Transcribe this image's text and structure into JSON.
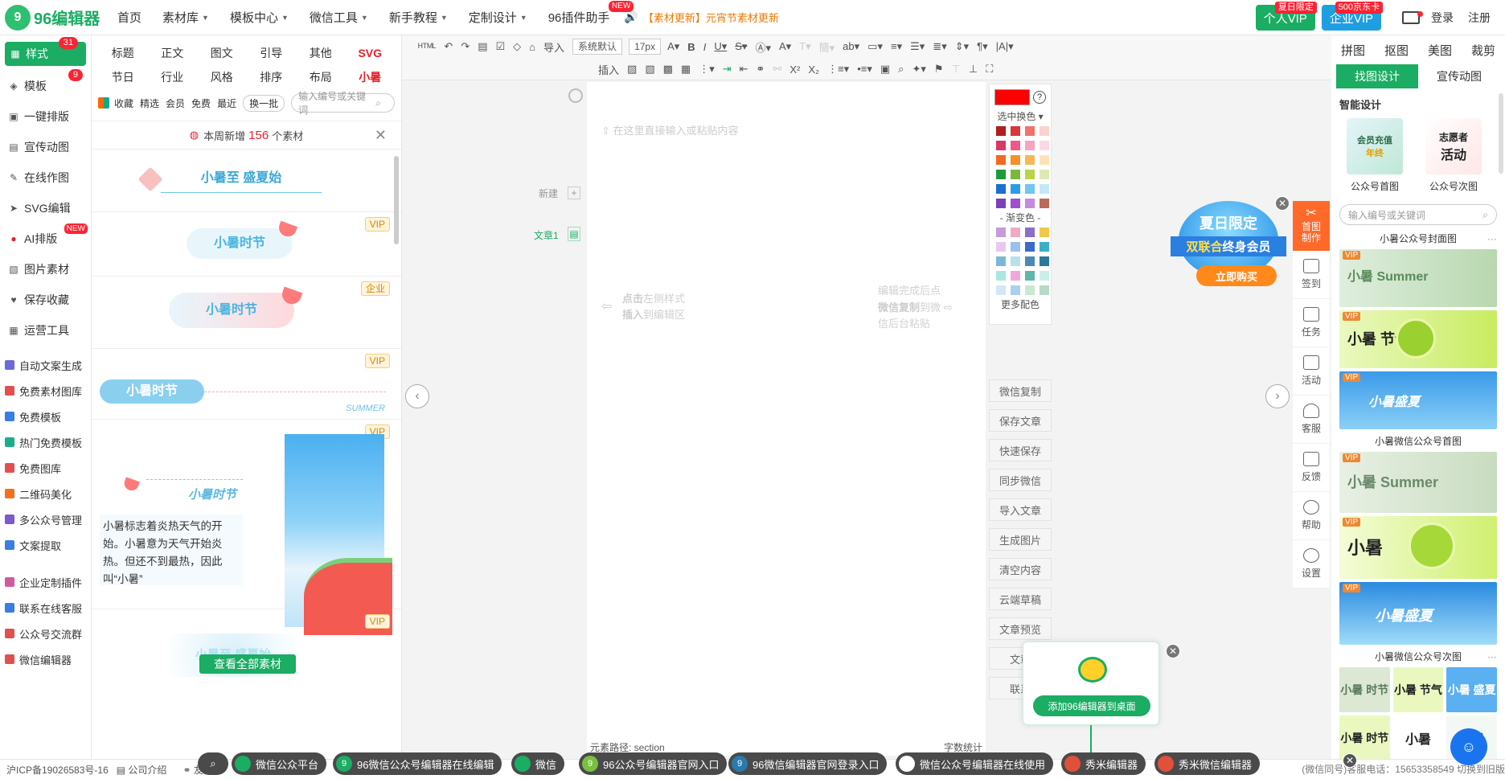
{
  "nav": {
    "logo_mark": "9",
    "logo_text": "96编辑器",
    "items": [
      {
        "label": "首页",
        "caret": false
      },
      {
        "label": "素材库",
        "caret": true
      },
      {
        "label": "模板中心",
        "caret": true
      },
      {
        "label": "微信工具",
        "caret": true
      },
      {
        "label": "新手教程",
        "caret": true
      },
      {
        "label": "定制设计",
        "caret": true
      },
      {
        "label": "96插件助手",
        "caret": false,
        "badge": "NEW"
      }
    ],
    "notice": "【素材更新】元宵节素材更新",
    "vip_personal": {
      "label": "个人VIP",
      "tag": "夏日限定",
      "color": "#1aad63"
    },
    "vip_enterprise": {
      "label": "企业VIP",
      "tag": "500京东卡",
      "color": "#1e9fe0"
    },
    "login": "登录",
    "register": "注册"
  },
  "sidebar": {
    "style": {
      "label": "样式",
      "count": "31"
    },
    "template": {
      "label": "模板",
      "count": "9"
    },
    "items": [
      "一键排版",
      "宣传动图",
      "在线作图",
      "SVG编辑",
      "AI排版",
      "图片素材",
      "保存收藏",
      "运营工具"
    ],
    "ai_badge": "NEW",
    "sub1": [
      {
        "label": "自动文案生成",
        "color": "#6a6ad8"
      },
      {
        "label": "免费素材图库",
        "color": "#e05050"
      },
      {
        "label": "免费模板",
        "color": "#3b7de0"
      },
      {
        "label": "热门免费模板",
        "color": "#1aad8a"
      },
      {
        "label": "免费图库",
        "color": "#e05050"
      },
      {
        "label": "二维码美化",
        "color": "#f07020"
      },
      {
        "label": "多公众号管理",
        "color": "#7a5ad0"
      },
      {
        "label": "文案提取",
        "color": "#3b7de0"
      }
    ],
    "sub2": [
      {
        "label": "企业定制插件",
        "color": "#d05aa0"
      },
      {
        "label": "联系在线客服",
        "color": "#3b7de0"
      },
      {
        "label": "公众号交流群",
        "color": "#e05050"
      },
      {
        "label": "微信编辑器",
        "color": "#e05050"
      }
    ]
  },
  "material": {
    "categories": [
      "标题",
      "正文",
      "图文",
      "引导",
      "其他",
      "SVG",
      "节日",
      "行业",
      "风格",
      "排序",
      "布局",
      "小暑"
    ],
    "filters": [
      "收藏",
      "精选",
      "会员",
      "免费",
      "最近"
    ],
    "swap": "换一批",
    "search_placeholder": "输入编号或关键词",
    "weekly_prefix": "本周新增",
    "weekly_count": "156",
    "weekly_suffix": "个素材",
    "items": [
      {
        "title": "小暑至 盛夏始",
        "tag": ""
      },
      {
        "title": "小暑时节",
        "tag": "VIP"
      },
      {
        "title": "小暑时节",
        "tag": "企业"
      },
      {
        "title": "小暑时节",
        "tag": "VIP",
        "sub": "SUMMER"
      },
      {
        "title": "小暑时节",
        "tag": "VIP",
        "body": "小暑标志着炎热天气的开始。小暑意为天气开始炎热。但还不到最热，因此叫“小暑”"
      },
      {
        "title": "小暑至 盛夏始",
        "tag": "VIP"
      }
    ],
    "view_all": "查看全部素材"
  },
  "toolbar": {
    "row1": [
      "导入",
      "系统默认",
      "17px"
    ],
    "row2": [
      "插入"
    ]
  },
  "editor": {
    "placeholder": "在这里直接输入或粘贴内容",
    "new_label": "新建",
    "article_label": "文章1",
    "hint_left_1a": "点击",
    "hint_left_1b": "左侧样式",
    "hint_left_2a": "插入",
    "hint_left_2b": "到编辑区",
    "hint_right_1": "编辑完成后点",
    "hint_right_2a": "微信复制",
    "hint_right_2b": "到微",
    "hint_right_3": "信后台粘贴",
    "path": "元素路径: section",
    "wordcount": "字数统计"
  },
  "colorpanel": {
    "swap_label": "选中换色",
    "gradient_label": "- 渐变色 -",
    "more": "更多配色",
    "solid": [
      "#b01e1e",
      "#d9373a",
      "#f2716c",
      "#fbd2cf",
      "#d93669",
      "#f0588a",
      "#f8a3c0",
      "#fcd8e4",
      "#ef6b1e",
      "#f59127",
      "#f7b859",
      "#fde2b8",
      "#1f9a3b",
      "#7ab83a",
      "#b9d44a",
      "#dde9b4",
      "#1a6fd0",
      "#2b9de8",
      "#6fc6f0",
      "#c3e8f9",
      "#7a3fb9",
      "#a04ed0",
      "#c48ae0",
      "#bc6a5a"
    ],
    "gradient": [
      "#c79bd8",
      "#f3a8c4",
      "#8a6fc8",
      "#f0c94a",
      "#e8c8f0",
      "#9ac0f0",
      "#3a6ac8",
      "#3ab0c8",
      "#7ab8d8",
      "#b8e0f0",
      "#4a8ab8",
      "#2a7a9a",
      "#a8e8e0",
      "#f0a8d8",
      "#5ab8a8",
      "#c8f0e8",
      "#d0e8f8",
      "#a8d0f0",
      "#c8e8d0",
      "#b8d8c8"
    ]
  },
  "actions": [
    "微信复制",
    "保存文章",
    "快速保存",
    "同步微信",
    "导入文章",
    "生成图片",
    "清空内容",
    "云端草稿",
    "文章预览",
    "文章",
    "联系"
  ],
  "right_tabs": {
    "row1": [
      "拼图",
      "抠图",
      "美图",
      "裁剪"
    ],
    "seg": [
      "找图设计",
      "宣传动图"
    ]
  },
  "iconbar": {
    "top": [
      "首图",
      "制作"
    ],
    "items": [
      "签到",
      "任务",
      "活动",
      "客服",
      "反馈",
      "帮助",
      "设置"
    ]
  },
  "design": {
    "heading": "智能设计",
    "cards": [
      {
        "label": "公众号首图",
        "thumb_a": "会员充值",
        "thumb_b": "年终"
      },
      {
        "label": "公众号次图",
        "thumb_a": "志愿者",
        "thumb_b": "活动"
      }
    ],
    "search_placeholder": "输入编号或关键词",
    "sections": [
      "小暑公众号封面图",
      "小暑微信公众号首图",
      "小暑微信公众号次图"
    ],
    "vip": "VIP",
    "img_text": [
      "小暑 Summer",
      "小暑 节气",
      "小暑盛夏",
      "小暑 Summer",
      "小暑",
      "小暑盛夏"
    ],
    "mini": [
      "小暑 时节",
      "小暑 节气",
      "小暑 盛夏",
      "小暑 时节",
      "小暑",
      "小暑"
    ]
  },
  "promo": {
    "title": "夏日限定",
    "sub_a": "双联合",
    "sub_b": "终身会员",
    "button": "立即购买"
  },
  "popup": {
    "button": "添加96编辑器到桌面"
  },
  "bottom": {
    "icp": "沪ICP备19026583号-16",
    "company": "公司介绍",
    "friend": "友情",
    "pills": [
      "微信公众平台",
      "96微信公众号编辑器在线编辑",
      "微信",
      "96公众号编辑器官网入口",
      "96微信编辑器官网登录入口",
      "微信公众号编辑器在线使用",
      "秀米编辑器",
      "秀米微信编辑器"
    ],
    "right": "(微信同号)客服电话：15653358549  切换到旧版"
  }
}
